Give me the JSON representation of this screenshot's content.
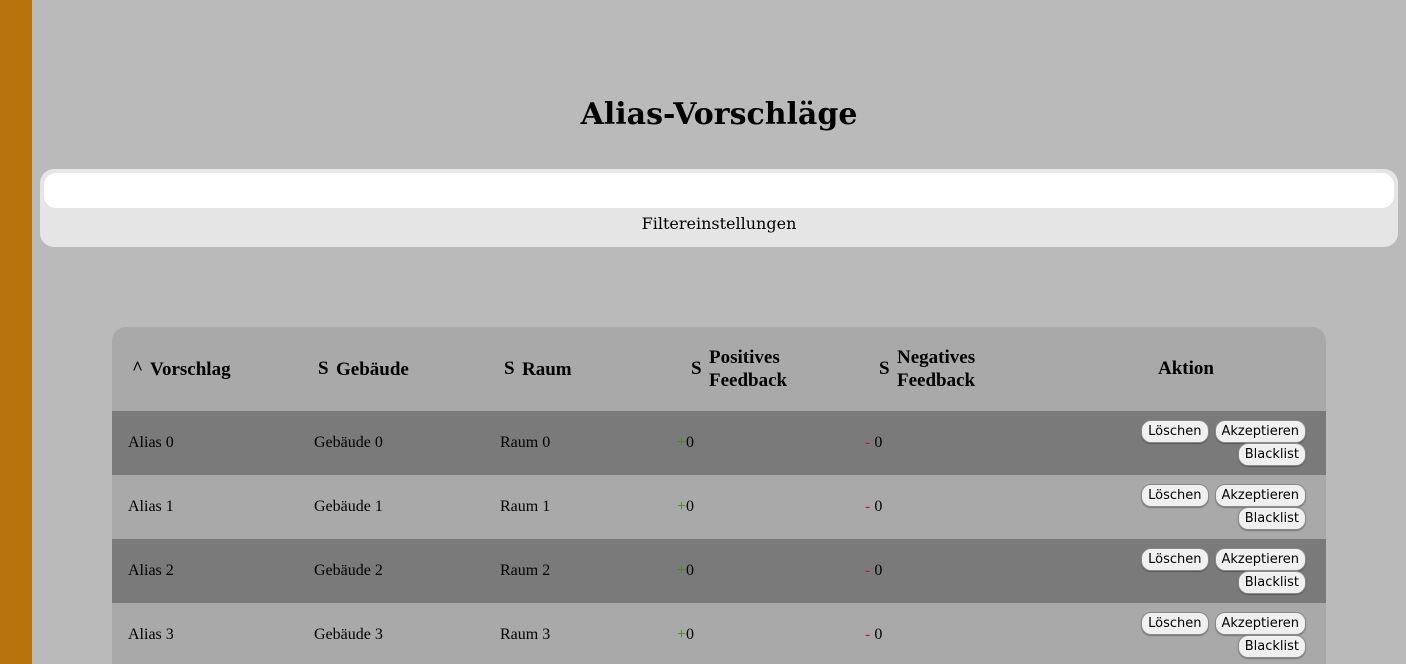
{
  "page": {
    "title": "Alias-Vorschläge"
  },
  "filter": {
    "input_value": "",
    "label": "Filtereinstellungen"
  },
  "table": {
    "columns": [
      {
        "sort": "^",
        "label": "Vorschlag"
      },
      {
        "sort": "S",
        "label": "Gebäude"
      },
      {
        "sort": "S",
        "label": "Raum"
      },
      {
        "sort": "S",
        "label": "Positives Feedback"
      },
      {
        "sort": "S",
        "label": "Negatives Feedback"
      },
      {
        "sort": "",
        "label": "Aktion"
      }
    ],
    "rows": [
      {
        "vorschlag": "Alias 0",
        "gebaeude": "Gebäude 0",
        "raum": "Raum 0",
        "pos_sign": "+",
        "pos": "0",
        "neg_sign": "-",
        "neg": "0"
      },
      {
        "vorschlag": "Alias 1",
        "gebaeude": "Gebäude 1",
        "raum": "Raum 1",
        "pos_sign": "+",
        "pos": "0",
        "neg_sign": "-",
        "neg": "0"
      },
      {
        "vorschlag": "Alias 2",
        "gebaeude": "Gebäude 2",
        "raum": "Raum 2",
        "pos_sign": "+",
        "pos": "0",
        "neg_sign": "-",
        "neg": "0"
      },
      {
        "vorschlag": "Alias 3",
        "gebaeude": "Gebäude 3",
        "raum": "Raum 3",
        "pos_sign": "+",
        "pos": "0",
        "neg_sign": "-",
        "neg": "0"
      }
    ],
    "actions": {
      "delete_label": "Löschen",
      "accept_label": "Akzeptieren",
      "blacklist_label": "Blacklist"
    }
  },
  "colors": {
    "side_strip": "#b8730c",
    "background": "#bababa",
    "row_dark": "#7a7a7a",
    "row_light": "#a9a9a9",
    "plus": "#3a8a1a",
    "minus": "#b0204a"
  }
}
